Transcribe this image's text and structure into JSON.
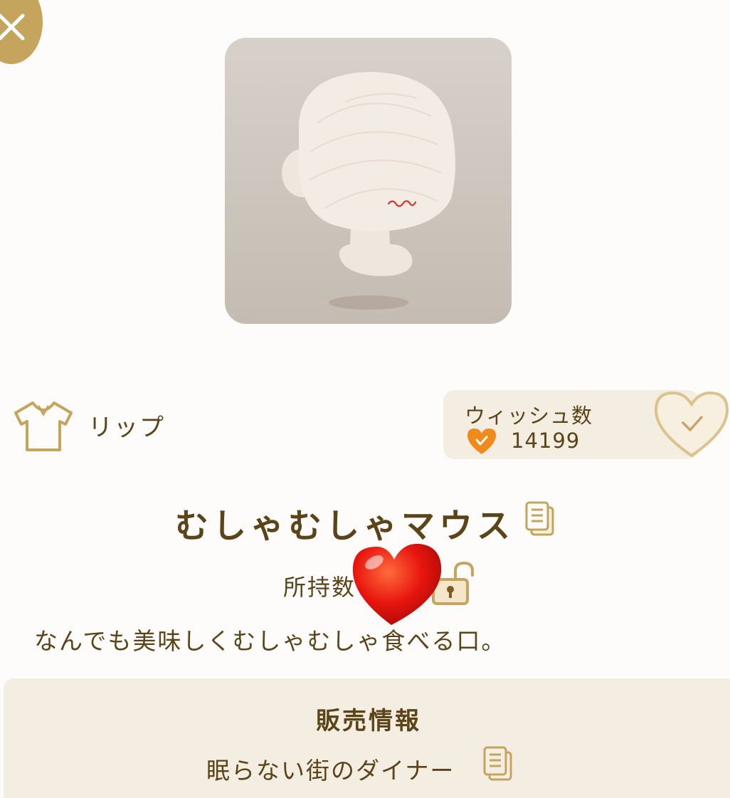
{
  "item": {
    "category_label": "リップ",
    "name": "むしゃむしゃマウス",
    "owned_label": "所持数",
    "description": "なんでも美味しくむしゃむしゃ食べる口。"
  },
  "wish": {
    "title": "ウィッシュ数",
    "count": "14199"
  },
  "sales": {
    "title": "販売情報",
    "source": "眠らない街のダイナー"
  },
  "icons": {
    "close": "close-icon",
    "category": "shirt-icon",
    "wish_count": "heart-check-icon",
    "wish_button": "heart-outline-check-icon",
    "copy": "copy-icon",
    "lock": "unlocked-padlock-icon",
    "sticker": "red-heart-sticker"
  },
  "colors": {
    "accent_gold": "#c5a45e",
    "text_brown": "#5a4418",
    "panel_beige": "#f4ede1",
    "wish_orange": "#f08a1c",
    "sticker_red": "#e8150e"
  }
}
